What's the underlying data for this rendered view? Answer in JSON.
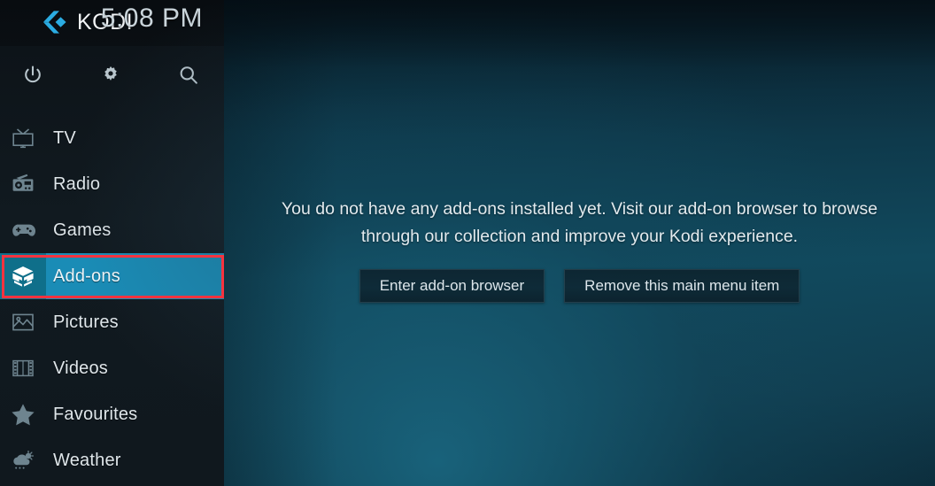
{
  "app": {
    "name": "Kodi",
    "logo_text": "KODI",
    "logo_color": "#2bace2"
  },
  "header": {
    "clock": "5:08 PM"
  },
  "sidebar": {
    "quick_icons": [
      {
        "name": "power-icon",
        "label": "Power"
      },
      {
        "name": "gear-icon",
        "label": "Settings"
      },
      {
        "name": "search-icon",
        "label": "Search"
      }
    ],
    "items": [
      {
        "label": "TV",
        "icon": "tv-icon",
        "selected": false
      },
      {
        "label": "Radio",
        "icon": "radio-icon",
        "selected": false
      },
      {
        "label": "Games",
        "icon": "gamepad-icon",
        "selected": false
      },
      {
        "label": "Add-ons",
        "icon": "addons-box-icon",
        "selected": true
      },
      {
        "label": "Pictures",
        "icon": "pictures-icon",
        "selected": false
      },
      {
        "label": "Videos",
        "icon": "filmstrip-icon",
        "selected": false
      },
      {
        "label": "Favourites",
        "icon": "star-icon",
        "selected": false
      },
      {
        "label": "Weather",
        "icon": "weather-icon",
        "selected": false
      }
    ],
    "selected_item": "Add-ons",
    "highlight_color": "#1a8cb6",
    "highlight_icon_color": "#0f6f8a"
  },
  "annotation": {
    "type": "rectangle",
    "target": "Add-ons",
    "color": "#f5333f"
  },
  "main": {
    "message": "You do not have any add-ons installed yet. Visit our add-on browser to browse through our collection and improve your Kodi experience.",
    "buttons": [
      {
        "label": "Enter add-on browser"
      },
      {
        "label": "Remove this main menu item"
      }
    ]
  }
}
